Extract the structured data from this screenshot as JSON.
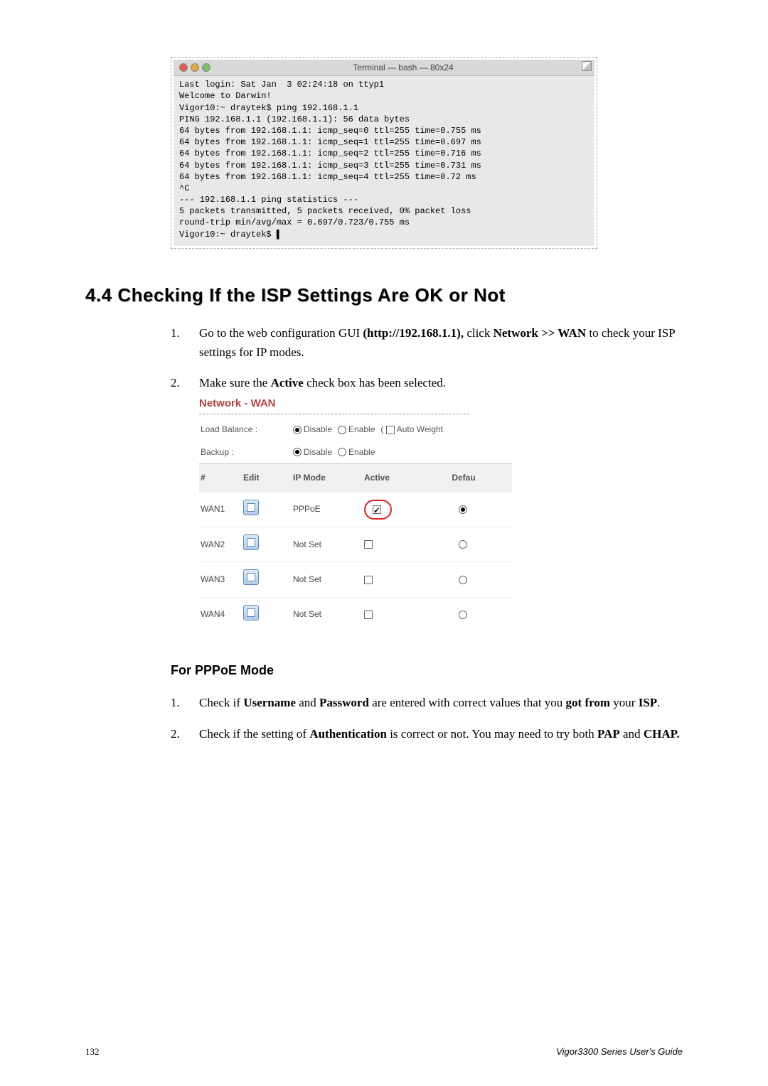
{
  "terminal": {
    "title": "Terminal — bash — 80x24",
    "body": "Last login: Sat Jan  3 02:24:18 on ttyp1\nWelcome to Darwin!\nVigor10:~ draytek$ ping 192.168.1.1\nPING 192.168.1.1 (192.168.1.1): 56 data bytes\n64 bytes from 192.168.1.1: icmp_seq=0 ttl=255 time=0.755 ms\n64 bytes from 192.168.1.1: icmp_seq=1 ttl=255 time=0.697 ms\n64 bytes from 192.168.1.1: icmp_seq=2 ttl=255 time=0.716 ms\n64 bytes from 192.168.1.1: icmp_seq=3 ttl=255 time=0.731 ms\n64 bytes from 192.168.1.1: icmp_seq=4 ttl=255 time=0.72 ms\n^C\n--- 192.168.1.1 ping statistics ---\n5 packets transmitted, 5 packets received, 0% packet loss\nround-trip min/avg/max = 0.697/0.723/0.755 ms\nVigor10:~ draytek$ ▌"
  },
  "heading": "4.4 Checking If the ISP Settings Are OK or Not",
  "step1": {
    "num": "1.",
    "pre": "Go to the web configuration GUI ",
    "bold1": "(http://192.168.1.1),",
    "mid": " click ",
    "bold2": "Network >> WAN",
    "post": " to check your ISP settings for IP modes."
  },
  "step2": {
    "num": "2.",
    "pre": "Make sure the ",
    "bold": "Active",
    "post": " check box has been selected."
  },
  "wan": {
    "title": "Network - WAN",
    "loadBalanceLabel": "Load Balance :",
    "backupLabel": "Backup :",
    "optDisable": "Disable",
    "optEnable": "Enable",
    "autoWeight": "Auto Weight",
    "headers": {
      "num": "#",
      "edit": "Edit",
      "mode": "IP Mode",
      "active": "Active",
      "default": "Defau"
    },
    "rows": [
      {
        "name": "WAN1",
        "mode": "PPPoE",
        "active": true,
        "default": true,
        "circled": true
      },
      {
        "name": "WAN2",
        "mode": "Not Set",
        "active": false,
        "default": false,
        "circled": false
      },
      {
        "name": "WAN3",
        "mode": "Not Set",
        "active": false,
        "default": false,
        "circled": false
      },
      {
        "name": "WAN4",
        "mode": "Not Set",
        "active": false,
        "default": false,
        "circled": false
      }
    ]
  },
  "pppoe": {
    "heading": "For PPPoE Mode",
    "item1": {
      "num": "1.",
      "p1": "Check if ",
      "b1": "Username",
      "p2": " and ",
      "b2": "Password",
      "p3": " are entered with correct values that you ",
      "b3": "got from",
      "p4": " your ",
      "b4": "ISP",
      "p5": "."
    },
    "item2": {
      "num": "2.",
      "p1": "Check if the setting of ",
      "b1": "Authentication",
      "p2": " is correct or not. You may need to try both ",
      "b2": "PAP",
      "p3": " and ",
      "b3": "CHAP.",
      "p4": ""
    }
  },
  "footer": {
    "page": "132",
    "guide": "Vigor3300  Series  User's  Guide"
  }
}
